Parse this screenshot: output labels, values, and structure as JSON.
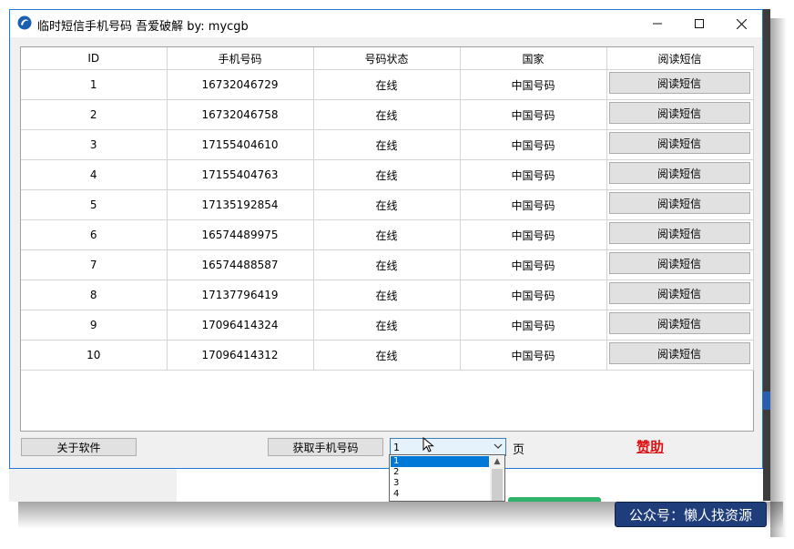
{
  "window": {
    "title": "临时短信手机号码 吾爱破解 by: mycgb"
  },
  "table": {
    "headers": [
      "ID",
      "手机号码",
      "号码状态",
      "国家",
      "阅读短信"
    ],
    "rows": [
      {
        "id": "1",
        "phone": "16732046729",
        "status": "在线",
        "country": "中国号码",
        "action": "阅读短信"
      },
      {
        "id": "2",
        "phone": "16732046758",
        "status": "在线",
        "country": "中国号码",
        "action": "阅读短信"
      },
      {
        "id": "3",
        "phone": "17155404610",
        "status": "在线",
        "country": "中国号码",
        "action": "阅读短信"
      },
      {
        "id": "4",
        "phone": "17155404763",
        "status": "在线",
        "country": "中国号码",
        "action": "阅读短信"
      },
      {
        "id": "5",
        "phone": "17135192854",
        "status": "在线",
        "country": "中国号码",
        "action": "阅读短信"
      },
      {
        "id": "6",
        "phone": "16574489975",
        "status": "在线",
        "country": "中国号码",
        "action": "阅读短信"
      },
      {
        "id": "7",
        "phone": "16574488587",
        "status": "在线",
        "country": "中国号码",
        "action": "阅读短信"
      },
      {
        "id": "8",
        "phone": "17137796419",
        "status": "在线",
        "country": "中国号码",
        "action": "阅读短信"
      },
      {
        "id": "9",
        "phone": "17096414324",
        "status": "在线",
        "country": "中国号码",
        "action": "阅读短信"
      },
      {
        "id": "10",
        "phone": "17096414312",
        "status": "在线",
        "country": "中国号码",
        "action": "阅读短信"
      }
    ]
  },
  "controls": {
    "about_label": "关于软件",
    "fetch_label": "获取手机号码",
    "page_value": "1",
    "page_suffix": "页",
    "sponsor_label": "赞助"
  },
  "dropdown": {
    "options": [
      "1",
      "2",
      "3",
      "4"
    ],
    "selected": "1"
  },
  "overlay": {
    "wechat_label": "公众号：懒人找资源"
  },
  "colors": {
    "sponsor": "#e01010",
    "window_border": "#1e7ad8",
    "selection": "#0078d7",
    "wechat_bg": "#1f3d7a"
  },
  "icons": {
    "app": "app-logo-icon",
    "minimize": "minimize-icon",
    "maximize": "maximize-icon",
    "close": "close-icon",
    "dropdown": "chevron-down-icon",
    "cursor": "mouse-cursor-icon"
  }
}
